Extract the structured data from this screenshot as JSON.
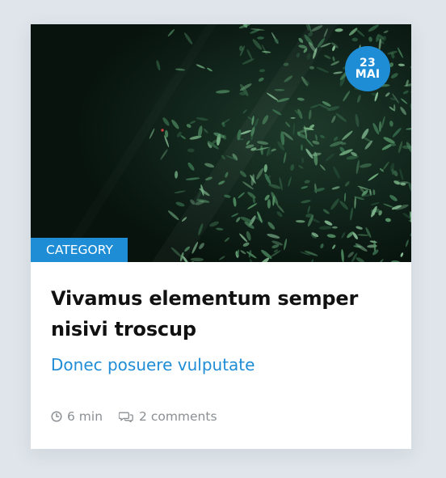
{
  "post": {
    "date_day": "23",
    "date_month": "MAI",
    "category": "CATEGORY",
    "title": "Vivamus elementum semper nisivi troscup",
    "subtitle": "Donec posuere vulputate",
    "read_time": "6 min",
    "comments": "2 comments",
    "image_icon": "foliage-photo",
    "clock_icon": "clock-icon",
    "comments_icon": "comments-icon"
  },
  "colors": {
    "accent": "#1f8dd6",
    "title": "#111111",
    "meta": "#8b8f93",
    "background": "#dfe5ea"
  }
}
